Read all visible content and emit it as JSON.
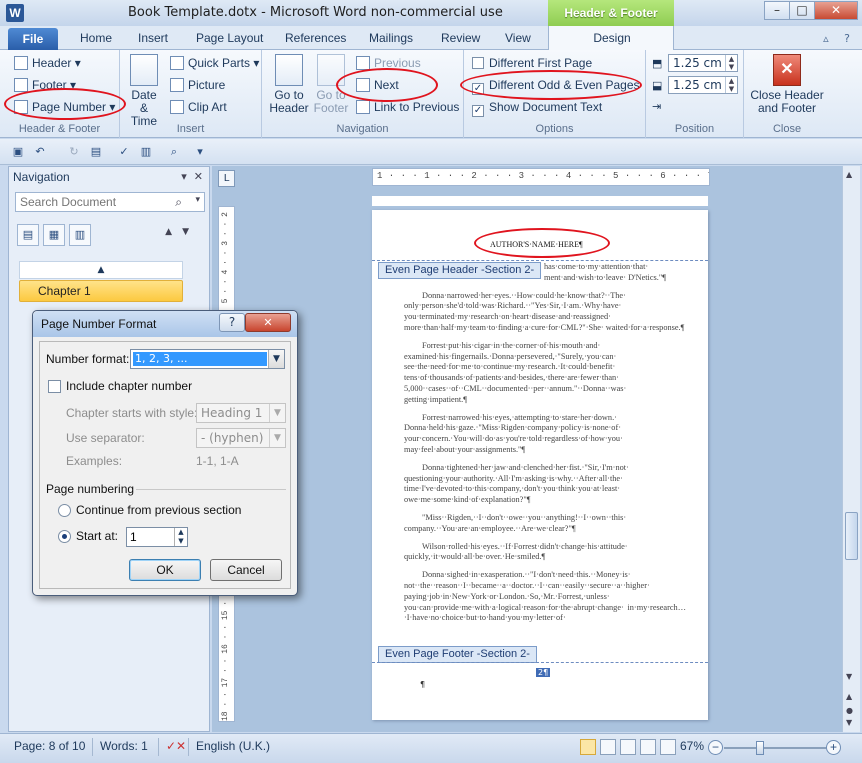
{
  "window": {
    "title": "Book Template.dotx - Microsoft Word non-commercial use",
    "contextual_label": "Header & Footer Tools",
    "app_icon_letter": "W"
  },
  "tabs": [
    "File",
    "Home",
    "Insert",
    "Page Layout",
    "References",
    "Mailings",
    "Review",
    "View"
  ],
  "active_tab": "Design",
  "ribbon": {
    "header_footer": {
      "label": "Header & Footer",
      "header": "Header",
      "footer": "Footer",
      "page_number": "Page Number"
    },
    "insert": {
      "label": "Insert",
      "date_time": "Date\n& Time",
      "quick_parts": "Quick Parts",
      "picture": "Picture",
      "clip_art": "Clip Art"
    },
    "navigation": {
      "label": "Navigation",
      "go_to_header": "Go to\nHeader",
      "go_to_footer": "Go to\nFooter",
      "previous": "Previous",
      "next": "Next",
      "link_to_previous": "Link to Previous"
    },
    "options": {
      "label": "Options",
      "different_first_page": "Different First Page",
      "different_odd_even": "Different Odd & Even Pages",
      "show_document_text": "Show Document Text",
      "different_first_page_checked": false,
      "different_odd_even_checked": true,
      "show_document_text_checked": true
    },
    "position": {
      "label": "Position",
      "header_from_top": "1.25 cm",
      "footer_from_bottom": "1.25 cm"
    },
    "close": {
      "label": "Close",
      "button": "Close Header\nand Footer"
    }
  },
  "navpane": {
    "title": "Navigation",
    "search_placeholder": "Search Document",
    "chapter_item": "Chapter 1"
  },
  "ruler": {
    "h_ticks": "1 · · · 1 · · · 2 · · · 3 · · · 4 · · · 5 · · · 6 · · · 7 · · · 8 · · · 9 · · · 10 · · · 11 · · · 12",
    "v_ticks": "18 · · 17 · · 16 · · 15 · · 14 · · 13 · · 12 · · 11 · · 10 · · 9 · · 8 · · 7 · · 6 · · 5 · · 4 · · 3 · · 2 · · 1"
  },
  "document": {
    "header_text": "AUTHOR'S·NAME·HERE¶",
    "header_tag": "Even Page Header -Section 2-",
    "footer_tag": "Even Page Footer -Section 2-",
    "footer_pilcrow": "¶",
    "page_number_field": "2¶",
    "paragraphs": [
      "has·come·to·my·attention·that· ment·and·wish·to·leave· D'Netics.\"¶",
      "Donna·narrowed·her·eyes.··How·could·he·know·that?··The· only·person·she'd·told·was·Richard.··\"Yes·Sir,·I·am.·Why·have· you·terminated·my·research·on·heart·disease·and·reassigned· more·than·half·my·team·to·finding·a·cure·for·CML?\"·She· waited·for·a·response.¶",
      "Forrest·put·his·cigar·in·the·corner·of·his·mouth·and· examined·his·fingernails.·Donna·persevered,·\"Surely,·you·can· see·the·need·for·me·to·continue·my·research.·It·could·benefit· tens·of·thousands·of·patients·and·besides,·there·are·fewer·than· 5,000··cases··of··CML··documented··per··annum.\"··Donna··was· getting·impatient.¶",
      "Forrest·narrowed·his·eyes,·attempting·to·stare·her·down.· Donna·held·his·gaze.·\"Miss·Rigden·company·policy·is·none·of· your·concern.·You·will·do·as·you're·told·regardless·of·how·you· may·feel·about·your·assignments.\"¶",
      "Donna·tightened·her·jaw·and·clenched·her·fist.·\"Sir,·I'm·not· questioning·your·authority.·All·I'm·asking·is·why.··After·all·the· time·I've·devoted·to·this·company,·don't·you·think·you·at·least· owe·me·some·kind·of·explanation?\"¶",
      "\"Miss··Rigden,··I··don't··owe··you··anything!··I··own··this· company.··You·are·an·employee.··Are·we·clear?\"¶",
      "Wilson·rolled·his·eyes.··If·Forrest·didn't·change·his·attitude· quickly,·it·would·all·be·over.·He·smiled.¶",
      "Donna·sighed·in·exasperation.··\"I·don't·need·this.··Money·is· not··the··reason··I··became··a··doctor.··I··can··easily··secure··a··higher· paying·job·in·New·York·or·London.·So,·Mr.·Forrest,·unless· you·can·provide·me·with·a·logical·reason·for·the·abrupt·change· in·my·research…·I·have·no·choice·but·to·hand·you·my·letter·of·"
    ]
  },
  "dialog": {
    "title": "Page Number Format",
    "help": "?",
    "close": "✕",
    "number_format_label": "Number format:",
    "number_format_value": "1, 2, 3, ...",
    "include_chapter_label": "Include chapter number",
    "chapter_starts_label": "Chapter starts with style:",
    "chapter_starts_value": "Heading 1",
    "use_separator_label": "Use separator:",
    "use_separator_value": "-  (hyphen)",
    "examples_label": "Examples:",
    "examples_value": "1-1, 1-A",
    "page_numbering_label": "Page numbering",
    "continue_label": "Continue from previous section",
    "start_at_label": "Start at:",
    "start_at_value": "1",
    "ok": "OK",
    "cancel": "Cancel"
  },
  "status": {
    "page": "Page: 8 of 10",
    "words": "Words: 1",
    "language": "English (U.K.)",
    "zoom": "67%"
  },
  "colors": {
    "annotation_circle": "#e0141e",
    "contextual_tab": "#8fcd52",
    "file_tab": "#2a5ea9",
    "chapter_highlight": "#fcc940"
  }
}
